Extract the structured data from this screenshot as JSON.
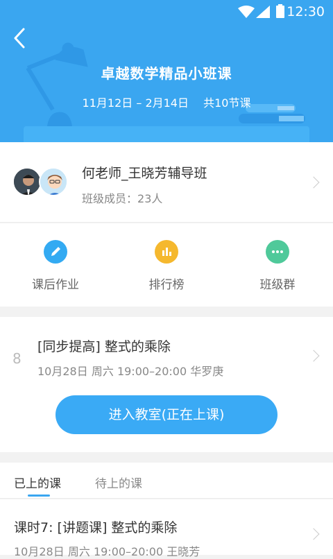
{
  "status_bar": {
    "time": "12:30",
    "wifi_icon": "wifi-icon",
    "signal_icon": "signal-icon",
    "battery_icon": "battery-icon"
  },
  "header": {
    "back_icon": "back-arrow-icon",
    "title": "卓越数学精品小班课",
    "date_range": "11月12日 – 2月14日",
    "lesson_count": "共10节课",
    "colors": {
      "background": "#3aa6f0",
      "text": "#ffffff"
    }
  },
  "class_info": {
    "name": "何老师_王晓芳辅导班",
    "member_label": "班级成员：",
    "member_count": "23人"
  },
  "shortcuts": [
    {
      "label": "课后作业",
      "icon": "pencil-icon",
      "color": "#33aaf2"
    },
    {
      "label": "排行榜",
      "icon": "bar-chart-icon",
      "color": "#f5b82e"
    },
    {
      "label": "班级群",
      "icon": "chat-bubble-icon",
      "color": "#4fc99a"
    }
  ],
  "current_lesson": {
    "number": "8",
    "title": "[同步提高] 整式的乘除",
    "date": "10月28日",
    "weekday": "周六",
    "time": "19:00–20:00",
    "teacher": "华罗庚",
    "enter_button": "进入教室(正在上课)"
  },
  "tabs": [
    {
      "label": "已上的课",
      "active": true
    },
    {
      "label": "待上的课",
      "active": false
    }
  ],
  "past_lesson": {
    "title": "课时7: [讲题课] 整式的乘除",
    "date": "10月28日",
    "weekday": "周六",
    "time": "19:00–20:00",
    "teacher": "王晓芳"
  }
}
